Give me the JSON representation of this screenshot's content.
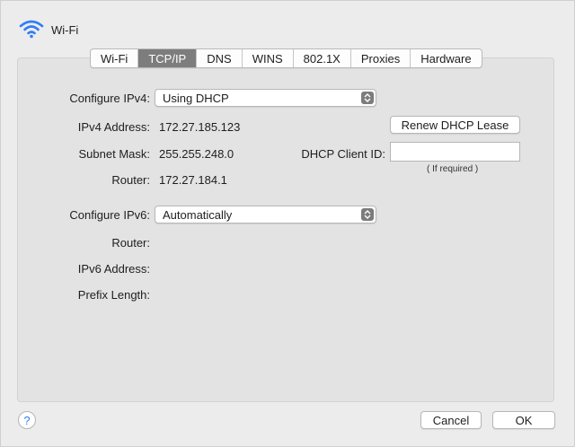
{
  "header": {
    "title": "Wi-Fi",
    "icon": "wifi-icon"
  },
  "tabs": [
    {
      "label": "Wi-Fi",
      "active": false
    },
    {
      "label": "TCP/IP",
      "active": true
    },
    {
      "label": "DNS",
      "active": false
    },
    {
      "label": "WINS",
      "active": false
    },
    {
      "label": "802.1X",
      "active": false
    },
    {
      "label": "Proxies",
      "active": false
    },
    {
      "label": "Hardware",
      "active": false
    }
  ],
  "ipv4": {
    "configure_label": "Configure IPv4:",
    "configure_value": "Using DHCP",
    "address_label": "IPv4 Address:",
    "address_value": "172.27.185.123",
    "subnet_label": "Subnet Mask:",
    "subnet_value": "255.255.248.0",
    "router_label": "Router:",
    "router_value": "172.27.184.1"
  },
  "dhcp": {
    "renew_label": "Renew DHCP Lease",
    "client_id_label": "DHCP Client ID:",
    "client_id_value": "",
    "hint": "( If required )"
  },
  "ipv6": {
    "configure_label": "Configure IPv6:",
    "configure_value": "Automatically",
    "router_label": "Router:",
    "address_label": "IPv6 Address:",
    "prefix_label": "Prefix Length:"
  },
  "footer": {
    "help_label": "?",
    "cancel_label": "Cancel",
    "ok_label": "OK"
  },
  "colors": {
    "active_tab": "#7d7d7d",
    "help_accent": "#2f7cf6"
  }
}
